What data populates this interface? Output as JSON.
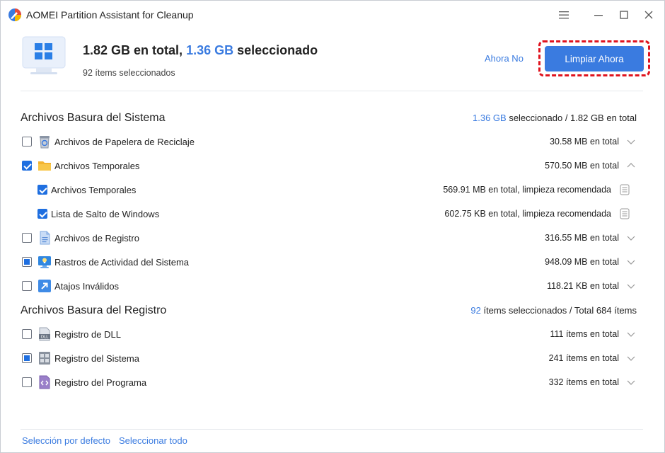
{
  "window": {
    "title": "AOMEI Partition Assistant for Cleanup"
  },
  "summary": {
    "total": "1.82 GB",
    "total_suffix": " en total, ",
    "selected": "1.36 GB",
    "selected_suffix": " seleccionado",
    "items_selected": "92 ítems seleccionados",
    "later_label": "Ahora No",
    "cleanup_label": "Limpiar Ahora"
  },
  "system": {
    "title": "Archivos Basura del Sistema",
    "summary_selected": "1.36 GB",
    "summary_rest": " seleccionado / 1.82 GB en total",
    "items": [
      {
        "label": "Archivos de Papelera de Reciclaje",
        "value": "30.58 MB en total",
        "icon": "recycle-bin-icon",
        "state": "unchecked"
      },
      {
        "label": "Archivos Temporales",
        "value": "570.50 MB en total",
        "icon": "folder-icon",
        "state": "checked"
      },
      {
        "label": "Archivos Temporales",
        "value": "569.91 MB en total, limpieza recomendada",
        "state": "checked"
      },
      {
        "label": "Lista de Salto de Windows",
        "value": "602.75 KB en total, limpieza recomendada",
        "state": "checked"
      },
      {
        "label": "Archivos de Registro",
        "value": "316.55 MB en total",
        "icon": "log-file-icon",
        "state": "unchecked"
      },
      {
        "label": "Rastros de Actividad del Sistema",
        "value": "948.09 MB en total",
        "icon": "monitor-bulb-icon",
        "state": "partial"
      },
      {
        "label": "Atajos Inválidos",
        "value": "118.21 KB en total",
        "icon": "shortcut-icon",
        "state": "unchecked"
      }
    ]
  },
  "registry": {
    "title": "Archivos Basura del Registro",
    "summary_selected": "92",
    "summary_rest": " ítems seleccionados / Total 684 ítems",
    "items": [
      {
        "label": "Registro de DLL",
        "value": "111 ítems en total",
        "icon": "dll-icon",
        "state": "unchecked"
      },
      {
        "label": "Registro del Sistema",
        "value": "241 ítems en total",
        "icon": "system-registry-icon",
        "state": "partial"
      },
      {
        "label": "Registro del Programa",
        "value": "332 ítems en total",
        "icon": "program-registry-icon",
        "state": "unchecked"
      }
    ]
  },
  "footer": {
    "default_selection": "Selección por defecto",
    "select_all": "Seleccionar todo"
  },
  "colors": {
    "accent": "#3a7be0",
    "highlight": "#e0131e"
  }
}
